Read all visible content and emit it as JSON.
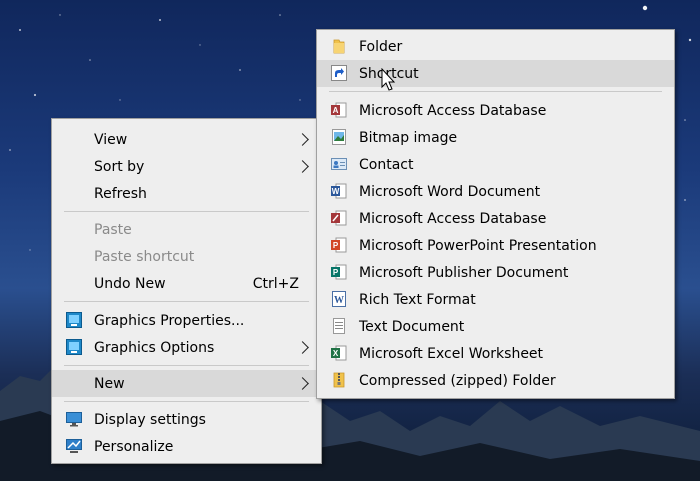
{
  "context_menu": {
    "items": [
      {
        "label": "View",
        "has_submenu": true
      },
      {
        "label": "Sort by",
        "has_submenu": true
      },
      {
        "label": "Refresh"
      },
      {
        "label": "Paste",
        "disabled": true
      },
      {
        "label": "Paste shortcut",
        "disabled": true
      },
      {
        "label": "Undo New",
        "shortcut": "Ctrl+Z"
      },
      {
        "label": "Graphics Properties...",
        "icon": "intel-graphics-icon"
      },
      {
        "label": "Graphics Options",
        "icon": "intel-graphics-icon",
        "has_submenu": true
      },
      {
        "label": "New",
        "has_submenu": true,
        "highlighted": true
      },
      {
        "label": "Display settings",
        "icon": "display-icon"
      },
      {
        "label": "Personalize",
        "icon": "personalize-icon"
      }
    ]
  },
  "new_submenu": {
    "items": [
      {
        "label": "Folder",
        "icon": "folder-icon"
      },
      {
        "label": "Shortcut",
        "icon": "shortcut-icon",
        "highlighted": true
      },
      {
        "label": "Microsoft Access Database",
        "icon": "access-icon"
      },
      {
        "label": "Bitmap image",
        "icon": "bitmap-icon"
      },
      {
        "label": "Contact",
        "icon": "contact-icon"
      },
      {
        "label": "Microsoft Word Document",
        "icon": "word-icon"
      },
      {
        "label": "Microsoft Access Database",
        "icon": "access-icon"
      },
      {
        "label": "Microsoft PowerPoint Presentation",
        "icon": "powerpoint-icon"
      },
      {
        "label": "Microsoft Publisher Document",
        "icon": "publisher-icon"
      },
      {
        "label": "Rich Text Format",
        "icon": "wordpad-icon"
      },
      {
        "label": "Text Document",
        "icon": "text-document-icon"
      },
      {
        "label": "Microsoft Excel Worksheet",
        "icon": "excel-icon"
      },
      {
        "label": "Compressed (zipped) Folder",
        "icon": "zip-folder-icon"
      }
    ]
  },
  "colors": {
    "menu_background": "#eeeeee",
    "highlight": "#d9d9d9",
    "disabled_text": "#8a8a8a",
    "access": "#a4373a",
    "word": "#2b579a",
    "powerpoint": "#d24726",
    "publisher": "#077568",
    "excel": "#217346",
    "folder": "#f0c24b"
  }
}
